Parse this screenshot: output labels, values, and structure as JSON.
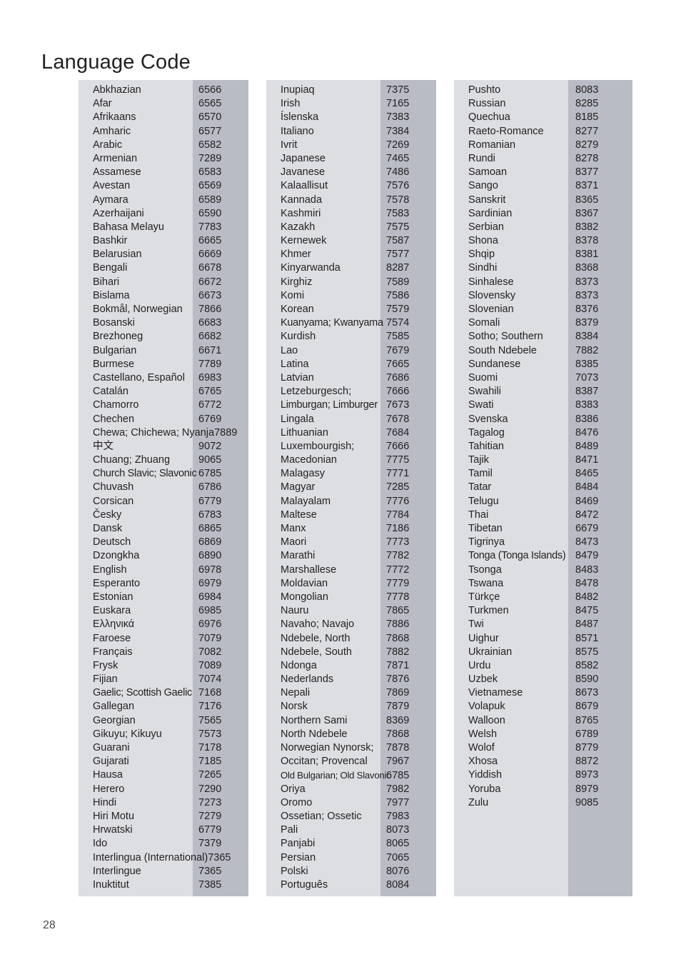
{
  "page": {
    "title": "Language Code",
    "number": "28"
  },
  "colors": {
    "panel_light": "#dcdee2",
    "panel_code_strip": "#b9bcc5",
    "text": "#231f20",
    "page_background": "#ffffff"
  },
  "columns": [
    {
      "id": "column-1",
      "entries": [
        {
          "name": "Abkhazian",
          "code": "6566"
        },
        {
          "name": "Afar",
          "code": "6565"
        },
        {
          "name": "Afrikaans",
          "code": "6570"
        },
        {
          "name": "Amharic",
          "code": "6577"
        },
        {
          "name": "Arabic",
          "code": "6582"
        },
        {
          "name": "Armenian",
          "code": "7289"
        },
        {
          "name": "Assamese",
          "code": "6583"
        },
        {
          "name": "Avestan",
          "code": "6569"
        },
        {
          "name": "Aymara",
          "code": "6589"
        },
        {
          "name": "Azerhaijani",
          "code": "6590"
        },
        {
          "name": "Bahasa Melayu",
          "code": "7783"
        },
        {
          "name": "Bashkir",
          "code": "6665"
        },
        {
          "name": "Belarusian",
          "code": "6669"
        },
        {
          "name": "Bengali",
          "code": "6678"
        },
        {
          "name": "Bihari",
          "code": "6672"
        },
        {
          "name": "Bislama",
          "code": "6673"
        },
        {
          "name": "Bokmål, Norwegian",
          "code": "7866"
        },
        {
          "name": "Bosanski",
          "code": "6683"
        },
        {
          "name": "Brezhoneg",
          "code": "6682"
        },
        {
          "name": "Bulgarian",
          "code": "6671"
        },
        {
          "name": "Burmese",
          "code": "7789"
        },
        {
          "name": "Castellano, Español",
          "code": "6983"
        },
        {
          "name": "Catalán",
          "code": "6765"
        },
        {
          "name": "Chamorro",
          "code": "6772"
        },
        {
          "name": "Chechen",
          "code": "6769"
        },
        {
          "name": "Chewa; Chichewa; Nyanja",
          "code": "7889",
          "style": "overflow"
        },
        {
          "name": "中文",
          "code": "9072",
          "style": "cjk"
        },
        {
          "name": "Chuang; Zhuang",
          "code": "9065"
        },
        {
          "name": "Church Slavic; Slavonic",
          "code": "6785",
          "style": "tight"
        },
        {
          "name": "Chuvash",
          "code": "6786"
        },
        {
          "name": "Corsican",
          "code": "6779"
        },
        {
          "name": "Česky",
          "code": "6783"
        },
        {
          "name": "Dansk",
          "code": "6865"
        },
        {
          "name": "Deutsch",
          "code": "6869"
        },
        {
          "name": "Dzongkha",
          "code": "6890"
        },
        {
          "name": "English",
          "code": "6978"
        },
        {
          "name": "Esperanto",
          "code": "6979"
        },
        {
          "name": "Estonian",
          "code": "6984"
        },
        {
          "name": "Euskara",
          "code": "6985"
        },
        {
          "name": "Ελληνικά",
          "code": "6976"
        },
        {
          "name": "Faroese",
          "code": "7079"
        },
        {
          "name": "Français",
          "code": "7082"
        },
        {
          "name": "Frysk",
          "code": "7089"
        },
        {
          "name": "Fijian",
          "code": "7074"
        },
        {
          "name": "Gaelic; Scottish Gaelic",
          "code": "7168",
          "style": "tight"
        },
        {
          "name": "Gallegan",
          "code": "7176"
        },
        {
          "name": "Georgian",
          "code": "7565"
        },
        {
          "name": "Gikuyu; Kikuyu",
          "code": "7573"
        },
        {
          "name": "Guarani",
          "code": "7178"
        },
        {
          "name": "Gujarati",
          "code": "7185"
        },
        {
          "name": "Hausa",
          "code": "7265"
        },
        {
          "name": "Herero",
          "code": "7290"
        },
        {
          "name": "Hindi",
          "code": "7273"
        },
        {
          "name": "Hiri Motu",
          "code": "7279"
        },
        {
          "name": "Hrwatski",
          "code": "6779"
        },
        {
          "name": "Ido",
          "code": "7379"
        },
        {
          "name": "Interlingua (International)",
          "code": "7365",
          "style": "overflow"
        },
        {
          "name": "Interlingue",
          "code": "7365"
        },
        {
          "name": "Inuktitut",
          "code": "7385"
        }
      ]
    },
    {
      "id": "column-2",
      "entries": [
        {
          "name": "Inupiaq",
          "code": "7375"
        },
        {
          "name": "Irish",
          "code": "7165"
        },
        {
          "name": "Íslenska",
          "code": "7383"
        },
        {
          "name": "Italiano",
          "code": "7384"
        },
        {
          "name": "Ivrit",
          "code": "7269"
        },
        {
          "name": "Japanese",
          "code": "7465"
        },
        {
          "name": "Javanese",
          "code": "7486"
        },
        {
          "name": "Kalaallisut",
          "code": "7576"
        },
        {
          "name": "Kannada",
          "code": "7578"
        },
        {
          "name": "Kashmiri",
          "code": "7583"
        },
        {
          "name": "Kazakh",
          "code": "7575"
        },
        {
          "name": "Kernewek",
          "code": "7587"
        },
        {
          "name": "Khmer",
          "code": "7577"
        },
        {
          "name": "Kinyarwanda",
          "code": "8287"
        },
        {
          "name": "Kirghiz",
          "code": "7589"
        },
        {
          "name": "Komi",
          "code": "7586"
        },
        {
          "name": "Korean",
          "code": "7579"
        },
        {
          "name": "Kuanyama; Kwanyama",
          "code": "7574",
          "style": "tight"
        },
        {
          "name": "Kurdish",
          "code": "7585"
        },
        {
          "name": "Lao",
          "code": "7679"
        },
        {
          "name": "Latina",
          "code": "7665"
        },
        {
          "name": "Latvian",
          "code": "7686"
        },
        {
          "name": "Letzeburgesch;",
          "code": "7666"
        },
        {
          "name": "Limburgan; Limburger",
          "code": "7673",
          "style": "tight"
        },
        {
          "name": "Lingala",
          "code": "7678"
        },
        {
          "name": "Lithuanian",
          "code": "7684"
        },
        {
          "name": "Luxembourgish;",
          "code": "7666"
        },
        {
          "name": "Macedonian",
          "code": "7775"
        },
        {
          "name": "Malagasy",
          "code": "7771"
        },
        {
          "name": "Magyar",
          "code": "7285"
        },
        {
          "name": "Malayalam",
          "code": "7776"
        },
        {
          "name": "Maltese",
          "code": "7784"
        },
        {
          "name": "Manx",
          "code": "7186"
        },
        {
          "name": "Maori",
          "code": "7773"
        },
        {
          "name": "Marathi",
          "code": "7782"
        },
        {
          "name": "Marshallese",
          "code": "7772"
        },
        {
          "name": "Moldavian",
          "code": "7779"
        },
        {
          "name": "Mongolian",
          "code": "7778"
        },
        {
          "name": "Nauru",
          "code": "7865"
        },
        {
          "name": "Navaho; Navajo",
          "code": "7886"
        },
        {
          "name": "Ndebele, North",
          "code": "7868"
        },
        {
          "name": "Ndebele, South",
          "code": "7882"
        },
        {
          "name": "Ndonga",
          "code": "7871"
        },
        {
          "name": "Nederlands",
          "code": "7876"
        },
        {
          "name": "Nepali",
          "code": "7869"
        },
        {
          "name": "Norsk",
          "code": "7879"
        },
        {
          "name": "Northern Sami",
          "code": "8369"
        },
        {
          "name": "North Ndebele",
          "code": "7868"
        },
        {
          "name": "Norwegian Nynorsk;",
          "code": "7878"
        },
        {
          "name": "Occitan; Provencal",
          "code": "7967"
        },
        {
          "name": "Old Bulgarian; Old Slavonic",
          "code": "6785",
          "style": "squeeze"
        },
        {
          "name": "Oriya",
          "code": "7982"
        },
        {
          "name": "Oromo",
          "code": "7977"
        },
        {
          "name": "Ossetian; Ossetic",
          "code": "7983"
        },
        {
          "name": "Pali",
          "code": "8073"
        },
        {
          "name": "Panjabi",
          "code": "8065"
        },
        {
          "name": "Persian",
          "code": "7065"
        },
        {
          "name": "Polski",
          "code": "8076"
        },
        {
          "name": "Português",
          "code": "8084"
        }
      ]
    },
    {
      "id": "column-3",
      "entries": [
        {
          "name": "Pushto",
          "code": "8083"
        },
        {
          "name": "Russian",
          "code": "8285"
        },
        {
          "name": "Quechua",
          "code": "8185"
        },
        {
          "name": "Raeto-Romance",
          "code": "8277"
        },
        {
          "name": "Romanian",
          "code": "8279"
        },
        {
          "name": "Rundi",
          "code": "8278"
        },
        {
          "name": "Samoan",
          "code": "8377"
        },
        {
          "name": "Sango",
          "code": "8371"
        },
        {
          "name": "Sanskrit",
          "code": "8365"
        },
        {
          "name": "Sardinian",
          "code": "8367"
        },
        {
          "name": "Serbian",
          "code": "8382"
        },
        {
          "name": "Shona",
          "code": "8378"
        },
        {
          "name": "Shqip",
          "code": "8381"
        },
        {
          "name": "Sindhi",
          "code": "8368"
        },
        {
          "name": "Sinhalese",
          "code": "8373"
        },
        {
          "name": "Slovensky",
          "code": "8373"
        },
        {
          "name": "Slovenian",
          "code": "8376"
        },
        {
          "name": "Somali",
          "code": "8379"
        },
        {
          "name": "Sotho; Southern",
          "code": "8384"
        },
        {
          "name": "South Ndebele",
          "code": "7882"
        },
        {
          "name": "Sundanese",
          "code": "8385"
        },
        {
          "name": "Suomi",
          "code": "7073"
        },
        {
          "name": "Swahili",
          "code": "8387"
        },
        {
          "name": "Swati",
          "code": "8383"
        },
        {
          "name": "Svenska",
          "code": "8386"
        },
        {
          "name": "Tagalog",
          "code": "8476"
        },
        {
          "name": "Tahitian",
          "code": "8489"
        },
        {
          "name": "Tajik",
          "code": "8471"
        },
        {
          "name": "Tamil",
          "code": "8465"
        },
        {
          "name": "Tatar",
          "code": "8484"
        },
        {
          "name": "Telugu",
          "code": "8469"
        },
        {
          "name": "Thai",
          "code": "8472"
        },
        {
          "name": "Tibetan",
          "code": "6679"
        },
        {
          "name": "Tigrinya",
          "code": "8473"
        },
        {
          "name": "Tonga (Tonga Islands)",
          "code": "8479",
          "style": "tight"
        },
        {
          "name": "Tsonga",
          "code": "8483"
        },
        {
          "name": "Tswana",
          "code": "8478"
        },
        {
          "name": "Türkçe",
          "code": "8482"
        },
        {
          "name": "Turkmen",
          "code": "8475"
        },
        {
          "name": "Twi",
          "code": "8487"
        },
        {
          "name": "Uighur",
          "code": "8571"
        },
        {
          "name": "Ukrainian",
          "code": "8575"
        },
        {
          "name": "Urdu",
          "code": "8582"
        },
        {
          "name": "Uzbek",
          "code": "8590"
        },
        {
          "name": "Vietnamese",
          "code": "8673"
        },
        {
          "name": "Volapuk",
          "code": "8679"
        },
        {
          "name": "Walloon",
          "code": "8765"
        },
        {
          "name": "Welsh",
          "code": "6789"
        },
        {
          "name": "Wolof",
          "code": "8779"
        },
        {
          "name": "Xhosa",
          "code": "8872"
        },
        {
          "name": "Yiddish",
          "code": "8973"
        },
        {
          "name": "Yoruba",
          "code": "8979"
        },
        {
          "name": "Zulu",
          "code": "9085"
        }
      ]
    }
  ]
}
